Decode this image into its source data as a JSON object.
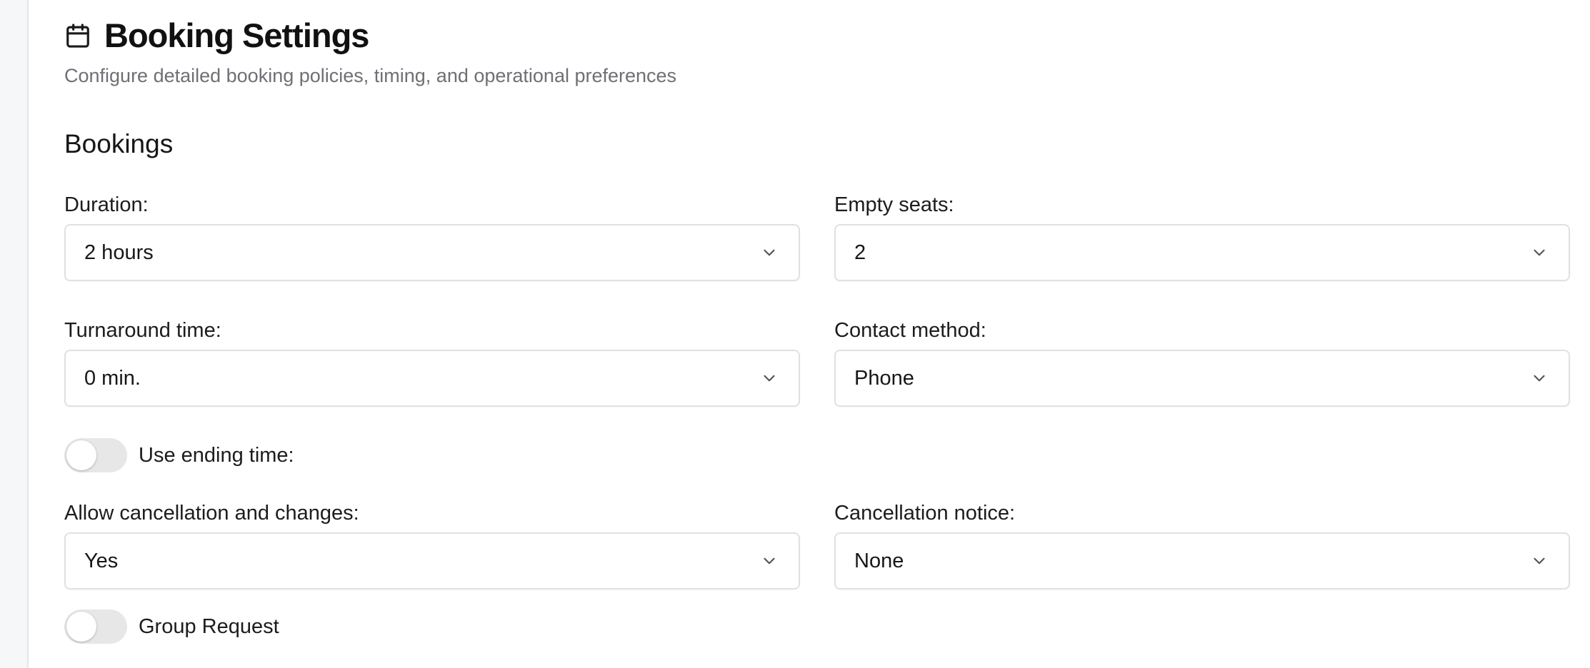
{
  "page": {
    "title": "Booking Settings",
    "subtitle": "Configure detailed booking policies, timing, and operational preferences",
    "title_icon": "calendar-icon"
  },
  "bookings": {
    "heading": "Bookings",
    "duration": {
      "label": "Duration:",
      "value": "2 hours"
    },
    "empty_seats": {
      "label": "Empty seats:",
      "value": "2"
    },
    "turnaround": {
      "label": "Turnaround time:",
      "value": "0 min."
    },
    "contact_method": {
      "label": "Contact method:",
      "value": "Phone"
    },
    "use_ending_time": {
      "label": "Use ending time:",
      "enabled": false
    },
    "allow_cancellation": {
      "label": "Allow cancellation and changes:",
      "value": "Yes"
    },
    "cancellation_notice": {
      "label": "Cancellation notice:",
      "value": "None"
    },
    "group_request": {
      "label": "Group Request",
      "enabled": false
    }
  },
  "colors": {
    "border": "#e1e1e4",
    "toggle_off": "#e7e7e7",
    "subtitle": "#6f6f75",
    "rail": "#f6f7f8"
  }
}
